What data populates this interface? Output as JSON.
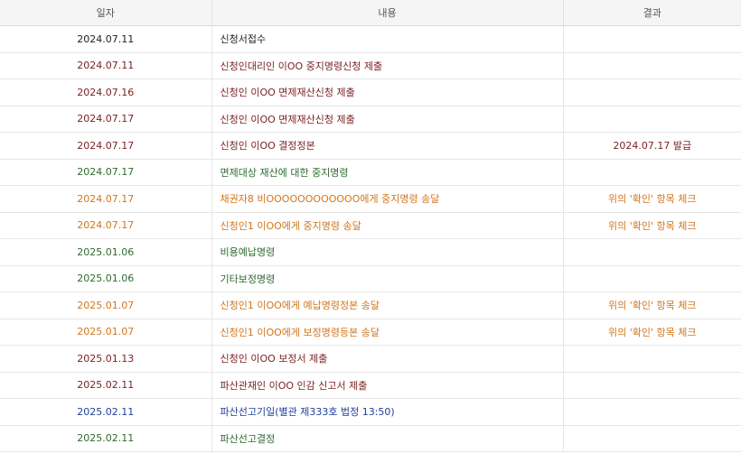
{
  "headers": {
    "date": "일자",
    "content": "내용",
    "result": "결과"
  },
  "colors": {
    "black": "#222222",
    "darkred": "#7b1f1f",
    "green": "#2e6b2e",
    "orange": "#d2761e",
    "blue": "#1f3f9a"
  },
  "rows": [
    {
      "date": "2024.07.11",
      "content": "신청서접수",
      "result": "",
      "color": "black"
    },
    {
      "date": "2024.07.11",
      "content": "신청인대리인 이OO 중지명령신청 제출",
      "result": "",
      "color": "darkred"
    },
    {
      "date": "2024.07.16",
      "content": "신청인 이OO 면제재산신청 제출",
      "result": "",
      "color": "darkred"
    },
    {
      "date": "2024.07.17",
      "content": "신청인 이OO 면제재산신청 제출",
      "result": "",
      "color": "darkred"
    },
    {
      "date": "2024.07.17",
      "content": "신청인 이OO 결정정본",
      "result": "2024.07.17 발급",
      "color": "darkred"
    },
    {
      "date": "2024.07.17",
      "content": "면제대상 재산에 대한 중지명령",
      "result": "",
      "color": "green"
    },
    {
      "date": "2024.07.17",
      "content": "채권자8 비OOOOOOOOOOOO에게 중지명령 송달",
      "result": "위의 '확인' 항목 체크",
      "color": "orange"
    },
    {
      "date": "2024.07.17",
      "content": "신청인1 이OO에게 중지명령 송달",
      "result": "위의 '확인' 항목 체크",
      "color": "orange"
    },
    {
      "date": "2025.01.06",
      "content": "비용예납명령",
      "result": "",
      "color": "green"
    },
    {
      "date": "2025.01.06",
      "content": "기타보정명령",
      "result": "",
      "color": "green"
    },
    {
      "date": "2025.01.07",
      "content": "신청인1 이OO에게 예납명령정본 송달",
      "result": "위의 '확인' 항목 체크",
      "color": "orange"
    },
    {
      "date": "2025.01.07",
      "content": "신청인1 이OO에게 보정명령등본 송달",
      "result": "위의 '확인' 항목 체크",
      "color": "orange"
    },
    {
      "date": "2025.01.13",
      "content": "신청인 이OO 보정서 제출",
      "result": "",
      "color": "darkred"
    },
    {
      "date": "2025.02.11",
      "content": "파산관재인 이OO 인감 신고서 제출",
      "result": "",
      "color": "darkred"
    },
    {
      "date": "2025.02.11",
      "content": "파산선고기일(별관 제333호 법정 13:50)",
      "result": "",
      "color": "blue"
    },
    {
      "date": "2025.02.11",
      "content": "파산선고결정",
      "result": "",
      "color": "green"
    }
  ]
}
